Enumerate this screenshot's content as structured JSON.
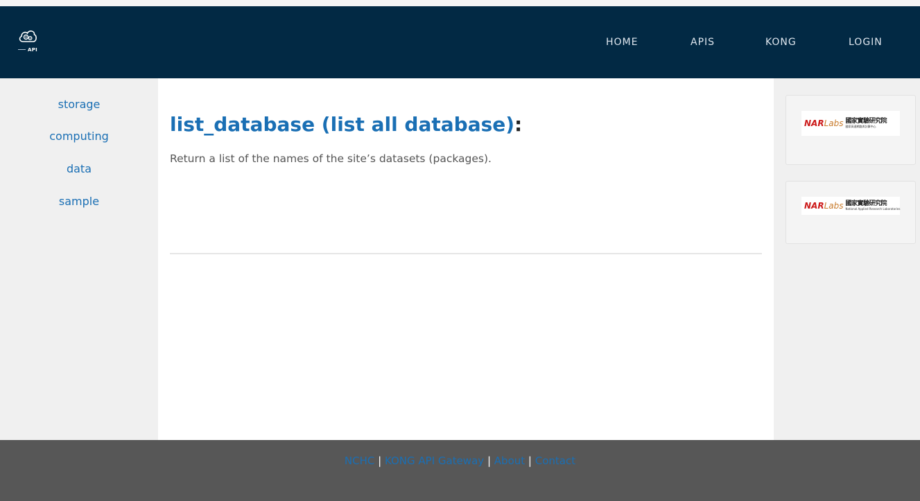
{
  "header": {
    "logo_text": "API",
    "nav": {
      "home": "HOME",
      "apis": "APIS",
      "kong": "KONG",
      "login": "LOGIN"
    }
  },
  "sidebar": {
    "items": [
      {
        "label": "storage"
      },
      {
        "label": "computing"
      },
      {
        "label": "data"
      },
      {
        "label": "sample"
      }
    ]
  },
  "main": {
    "title": "list_database (list all database)",
    "title_suffix": ":",
    "description": "Return a list of the names of the site’s datasets (packages)."
  },
  "partners": [
    {
      "brand_red": "NAR",
      "brand_labs": "Labs",
      "chinese": "國家實驗研究院",
      "subtitle": "國家高速網路與計算中心"
    },
    {
      "brand_red": "NAR",
      "brand_labs": "Labs",
      "chinese": "國家實驗研究院",
      "subtitle": "National Applied Research Laboratories"
    }
  ],
  "footer": {
    "links": [
      {
        "label": "NCHC"
      },
      {
        "label": "KONG API Gateway"
      },
      {
        "label": "About"
      },
      {
        "label": "Contact"
      }
    ],
    "separator": "|"
  },
  "colors": {
    "navbar_bg": "#022944",
    "link_blue": "#1a6fb4",
    "footer_bg": "#575757"
  }
}
